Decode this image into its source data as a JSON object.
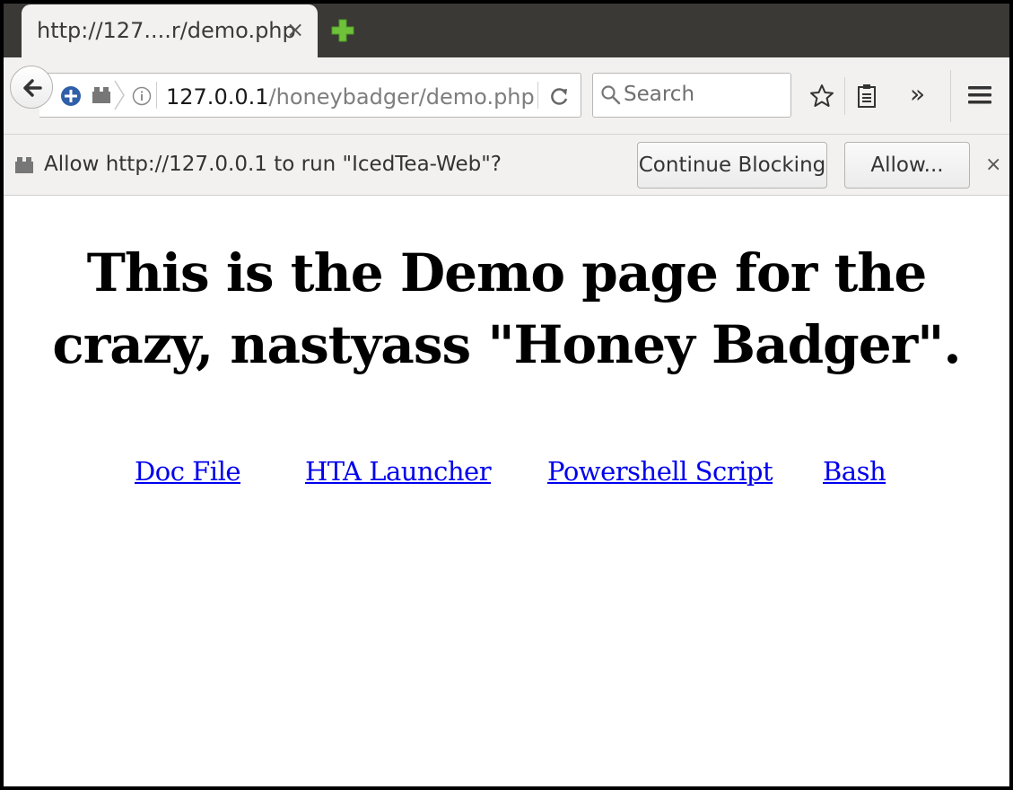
{
  "tab": {
    "title": "http://127....r/demo.php",
    "close_glyph": "×",
    "new_tab_icon": "plus-icon",
    "new_tab_color": "#6fc13a"
  },
  "navbar": {
    "url_host": "127.0.0.1",
    "url_path": "/honeybadger/demo.php",
    "search_placeholder": "Search",
    "overflow_glyph": "»"
  },
  "notification": {
    "message": "Allow http://127.0.0.1 to run \"IcedTea-Web\"?",
    "continue_blocking_label": "Continue Blocking",
    "allow_label": "Allow...",
    "close_glyph": "×"
  },
  "page": {
    "heading_line1": "This is the Demo page for the",
    "heading_line2": "crazy, nastyass \"Honey Badger\".",
    "links": [
      {
        "label": "Doc File"
      },
      {
        "label": "HTA Launcher"
      },
      {
        "label": "Powershell Script"
      },
      {
        "label": "Bash"
      }
    ],
    "link_color": "#0000ee"
  }
}
